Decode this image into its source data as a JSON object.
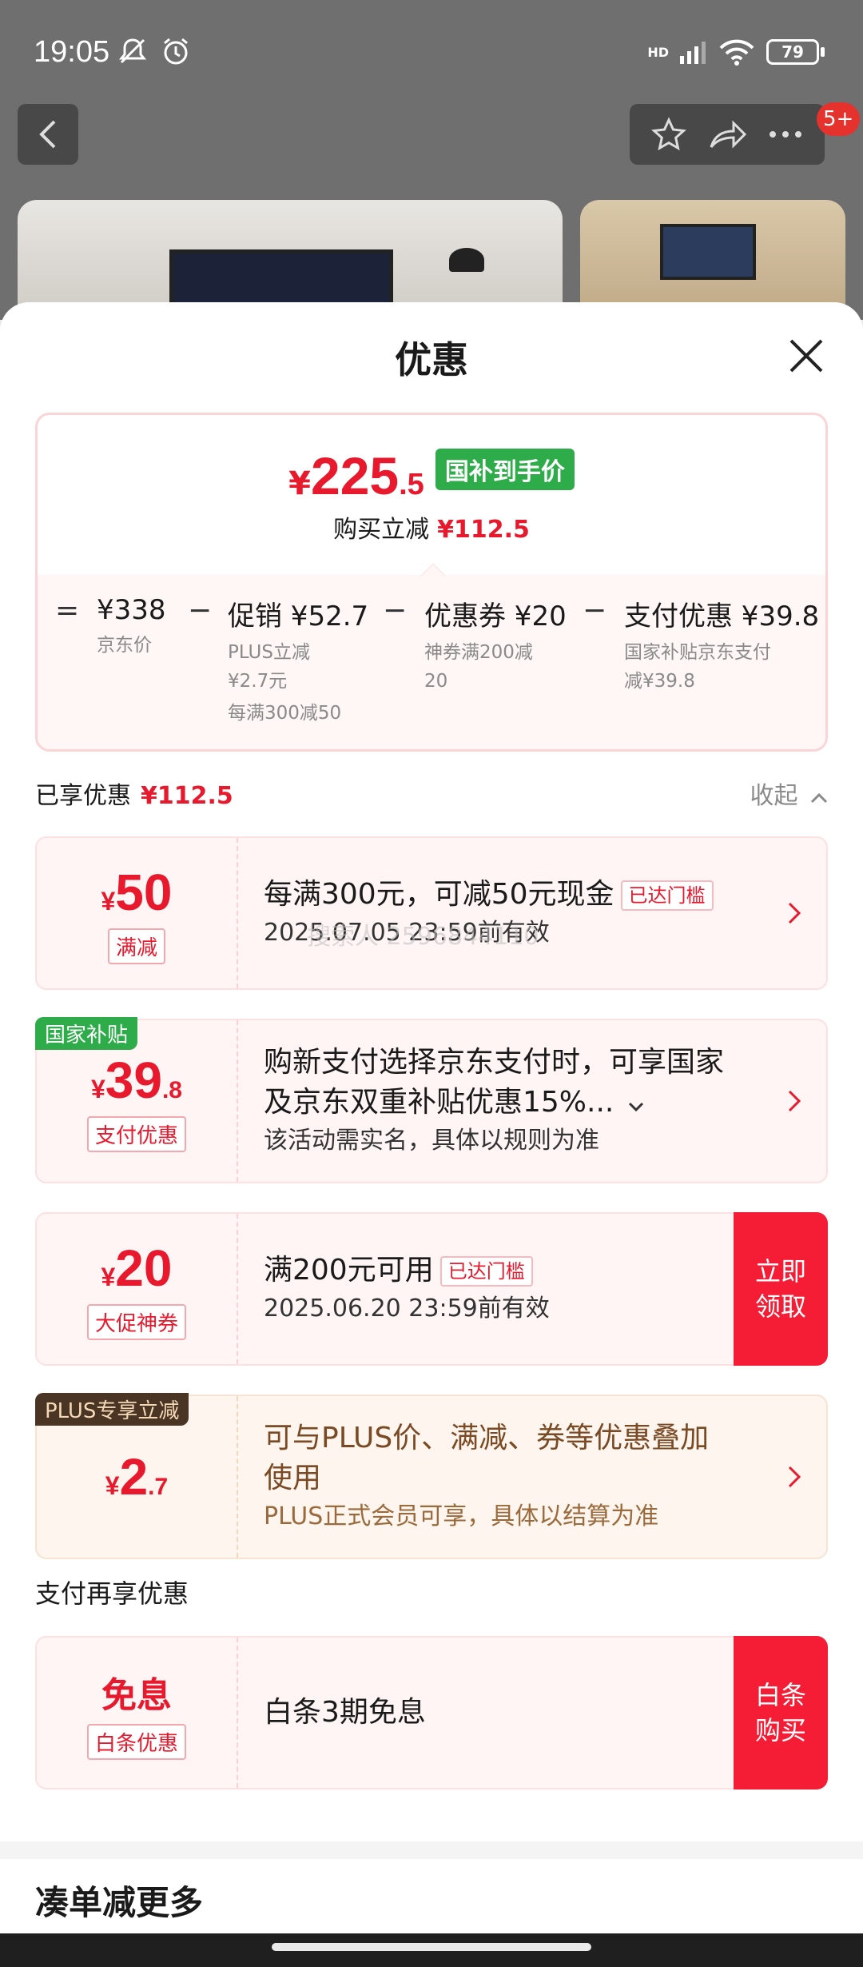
{
  "status": {
    "time": "19:05",
    "battery": "79",
    "net": "HD",
    "notifications": "5+"
  },
  "sheet": {
    "title": "优惠",
    "final_price": {
      "yen": "¥",
      "int": "225",
      "dec": ".5",
      "tag": "国补到手价"
    },
    "save": {
      "label": "购买立减",
      "amount": "¥112.5"
    },
    "formula": {
      "eq": "=",
      "minus": "−",
      "jd_price": {
        "value": "¥338",
        "sub": "京东价"
      },
      "promo": {
        "value": "促销 ¥52.7",
        "sub1": "PLUS立减",
        "sub2": "¥2.7元",
        "sub3": "每满300减50"
      },
      "coupon": {
        "value": "优惠券 ¥20",
        "sub1": "神券满200减",
        "sub2": "20"
      },
      "pay": {
        "value": "支付优惠 ¥39.8",
        "sub1": "国家补贴京东支付",
        "sub2": "减¥39.8"
      }
    },
    "enjoyed": {
      "label": "已享优惠",
      "amount": "¥112.5",
      "collapse": "收起"
    },
    "coupons": [
      {
        "yen": "¥",
        "amount": "50",
        "dec": "",
        "type": "满减",
        "title": "每满300元，可减50元现金",
        "badge": "已达门槛",
        "note": "2025.07.05 23:59前有效"
      },
      {
        "corner": "国家补贴",
        "yen": "¥",
        "amount": "39",
        "dec": ".8",
        "type": "支付优惠",
        "title1": "购新支付选择京东支付时，可享国家",
        "title2": "及京东双重补贴优惠15%...",
        "note": "该活动需实名，具体以规则为准"
      },
      {
        "yen": "¥",
        "amount": "20",
        "dec": "",
        "type": "大促神券",
        "title": "满200元可用",
        "badge": "已达门槛",
        "note": "2025.06.20 23:59前有效",
        "action1": "立即",
        "action2": "领取"
      },
      {
        "corner": "PLUS专享立减",
        "yen": "¥",
        "amount": "2",
        "dec": ".7",
        "title1": "可与PLUS价、满减、券等优惠叠加",
        "title2": "使用",
        "note": "PLUS正式会员可享，具体以结算为准"
      }
    ],
    "pay_section": "支付再享优惠",
    "baitiao": {
      "amount": "免息",
      "type": "白条优惠",
      "title": "白条3期免息",
      "action1": "白条",
      "action2": "购买"
    },
    "more_title": "凑单减更多",
    "watermark": "搜索人 2596844110"
  },
  "colors": {
    "accent": "#e8192c",
    "claim": "#f51d35",
    "national": "#2eac4a",
    "plus_tag": "#4a3423",
    "plus_text": "#8a5a2b"
  }
}
